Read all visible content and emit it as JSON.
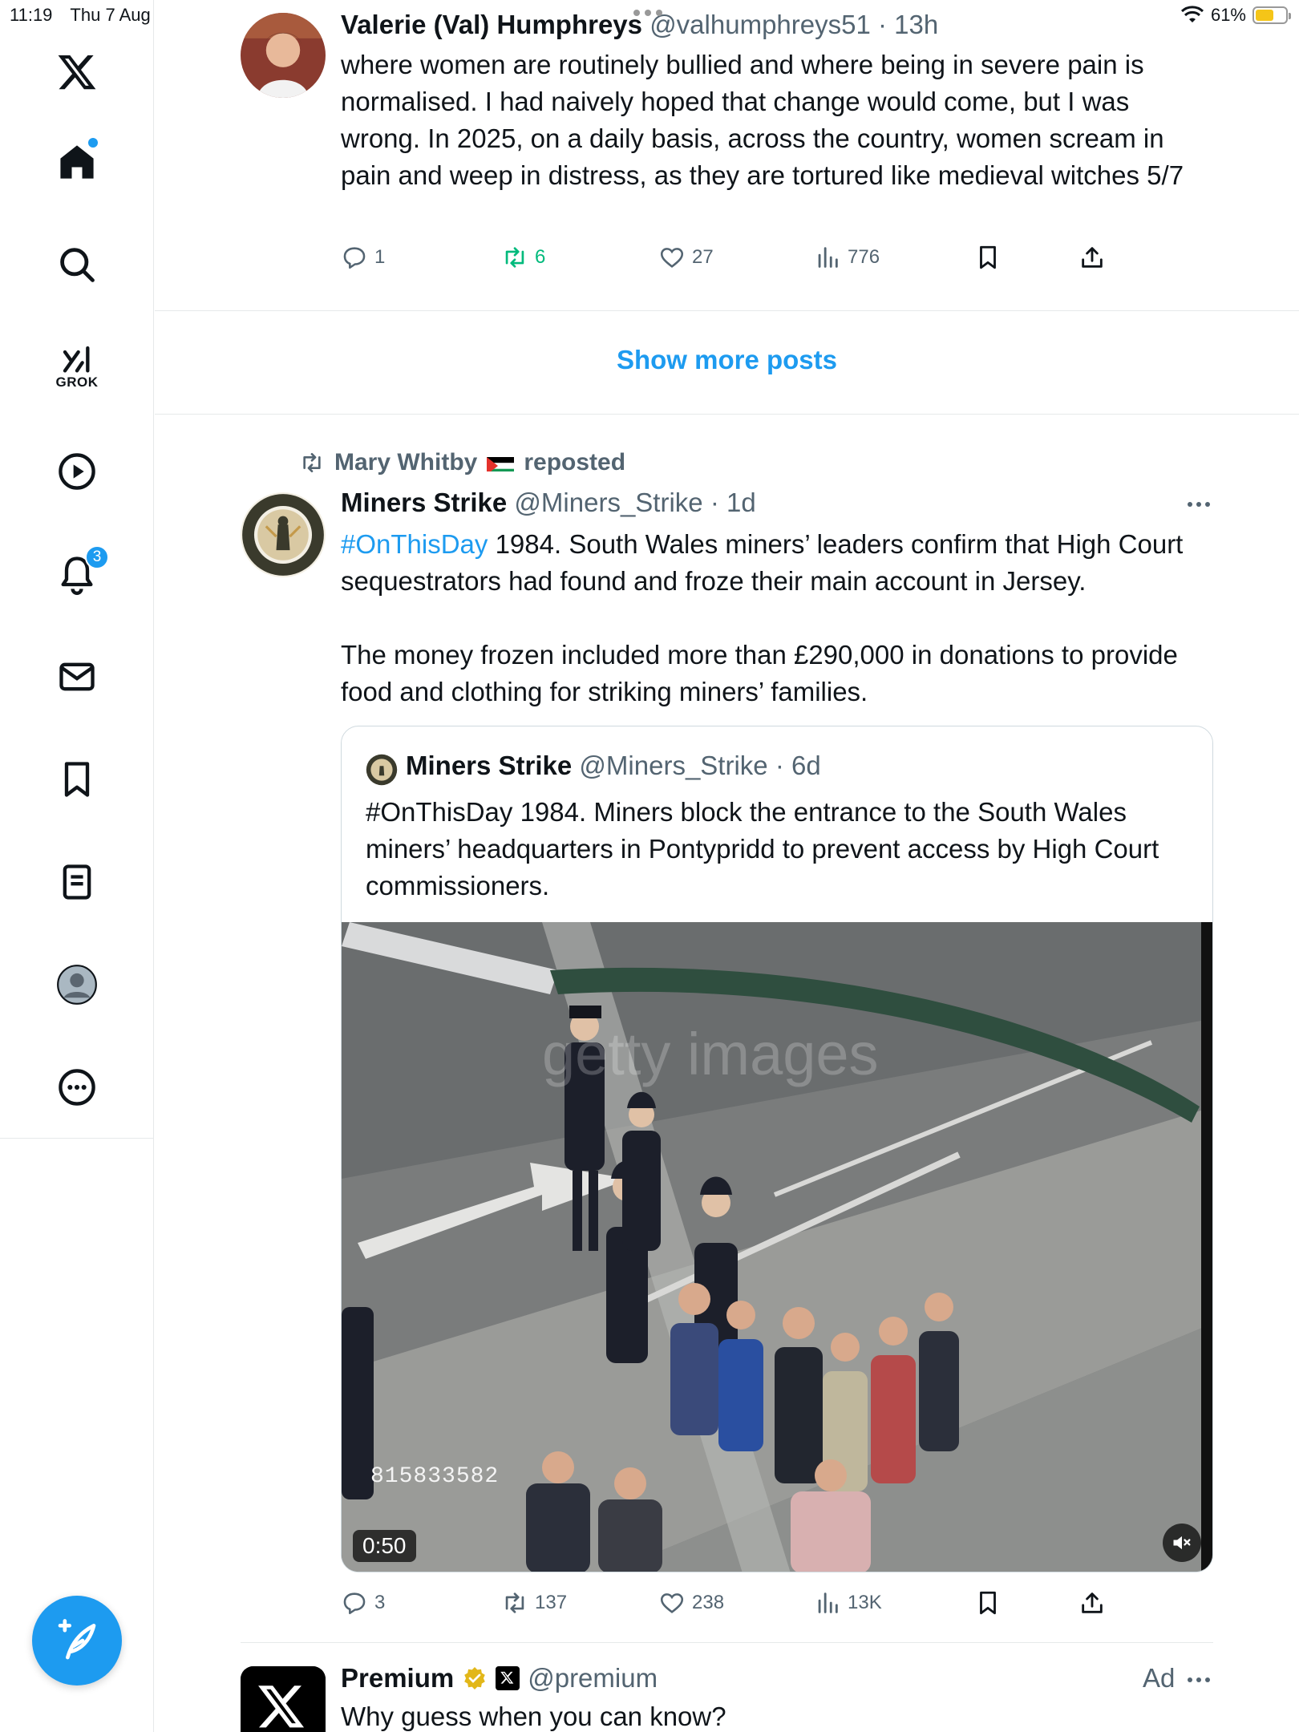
{
  "status_bar": {
    "time": "11:19",
    "date": "Thu 7 Aug",
    "battery": "61%"
  },
  "sidebar": {
    "grok_label": "GROK",
    "notifications_count": "3"
  },
  "post1": {
    "name": "Valerie (Val) Humphreys",
    "handle": "@valhumphreys51",
    "time": "13h",
    "text": "where women are routinely bullied and where being in severe pain is normalised. I had naively hoped that change would come, but I was wrong. In 2025, on a daily basis, across the country, women scream in pain and weep in distress, as they are tortured like medieval witches 5/7",
    "replies": "1",
    "reposts": "6",
    "likes": "27",
    "views": "776"
  },
  "show_more": "Show more posts",
  "post2": {
    "reposter": "Mary Whitby",
    "reposted_label": "reposted",
    "name": "Miners Strike",
    "handle": "@Miners_Strike",
    "time": "1d",
    "hashtag": "#OnThisDay",
    "text_line1": " 1984. South Wales miners’ leaders confirm that High Court sequestrators had found and froze their main account in Jersey.",
    "text_para2": "The money frozen included more than £290,000 in donations to provide food and clothing for striking miners’ families.",
    "quote": {
      "name": "Miners Strike",
      "handle": "@Miners_Strike",
      "time": "6d",
      "text": "#OnThisDay 1984. Miners block the entrance to the South Wales miners’ headquarters in Pontypridd to prevent access by High Court commissioners.",
      "video_code": "815833582",
      "duration": "0:50"
    },
    "replies": "3",
    "reposts": "137",
    "likes": "238",
    "views": "13K"
  },
  "post3": {
    "name": "Premium",
    "handle": "@premium",
    "ad_label": "Ad",
    "text": "Why guess when you can know?"
  }
}
